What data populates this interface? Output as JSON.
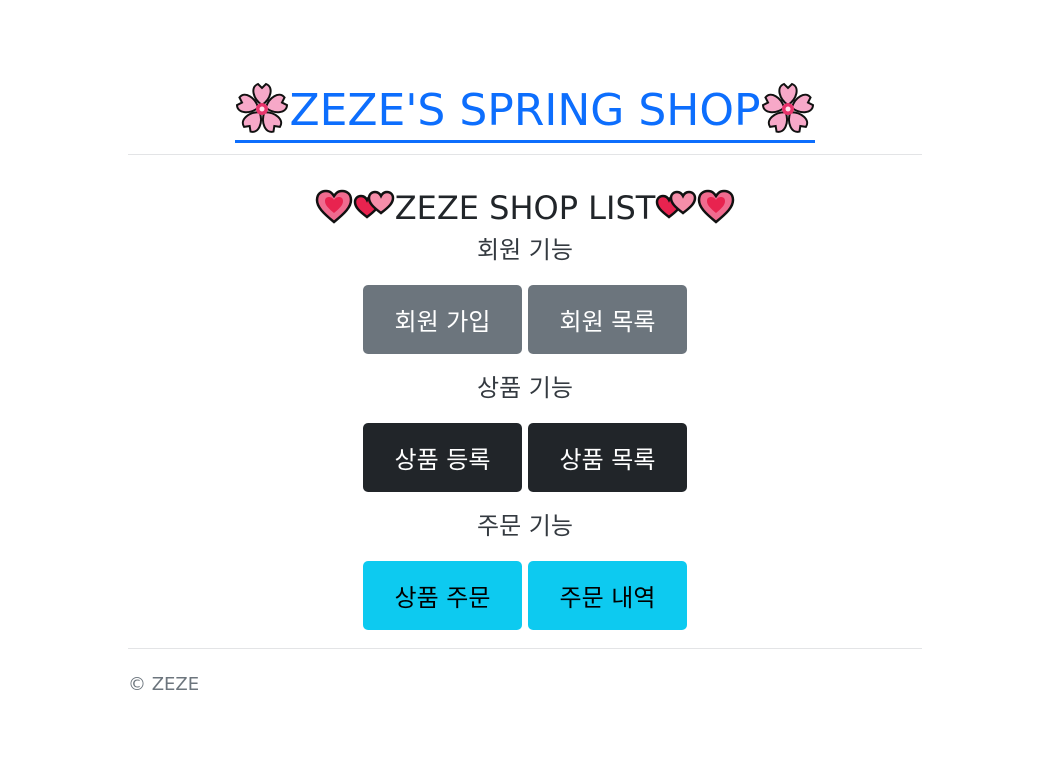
{
  "header": {
    "title": "ZEZE'S SPRING SHOP",
    "left_icon": "cherry-blossom-icon",
    "right_icon": "cherry-blossom-icon"
  },
  "main": {
    "list_title": "ZEZE SHOP LIST",
    "heart_icons": [
      "sparkling-heart-icon",
      "two-hearts-icon",
      "two-hearts-icon",
      "sparkling-heart-icon"
    ],
    "sections": [
      {
        "label": "회원 기능",
        "buttons": [
          "회원 가입",
          "회원 목록"
        ],
        "color": "#6c757d"
      },
      {
        "label": "상품 기능",
        "buttons": [
          "상품 등록",
          "상품 목록"
        ],
        "color": "#212529"
      },
      {
        "label": "주문 기능",
        "buttons": [
          "상품 주문",
          "주문 내역"
        ],
        "color": "#0dcaf0"
      }
    ]
  },
  "footer": {
    "copyright": "© ZEZE"
  },
  "colors": {
    "link": "#0d6efd",
    "divider": "#e3e4e6"
  }
}
